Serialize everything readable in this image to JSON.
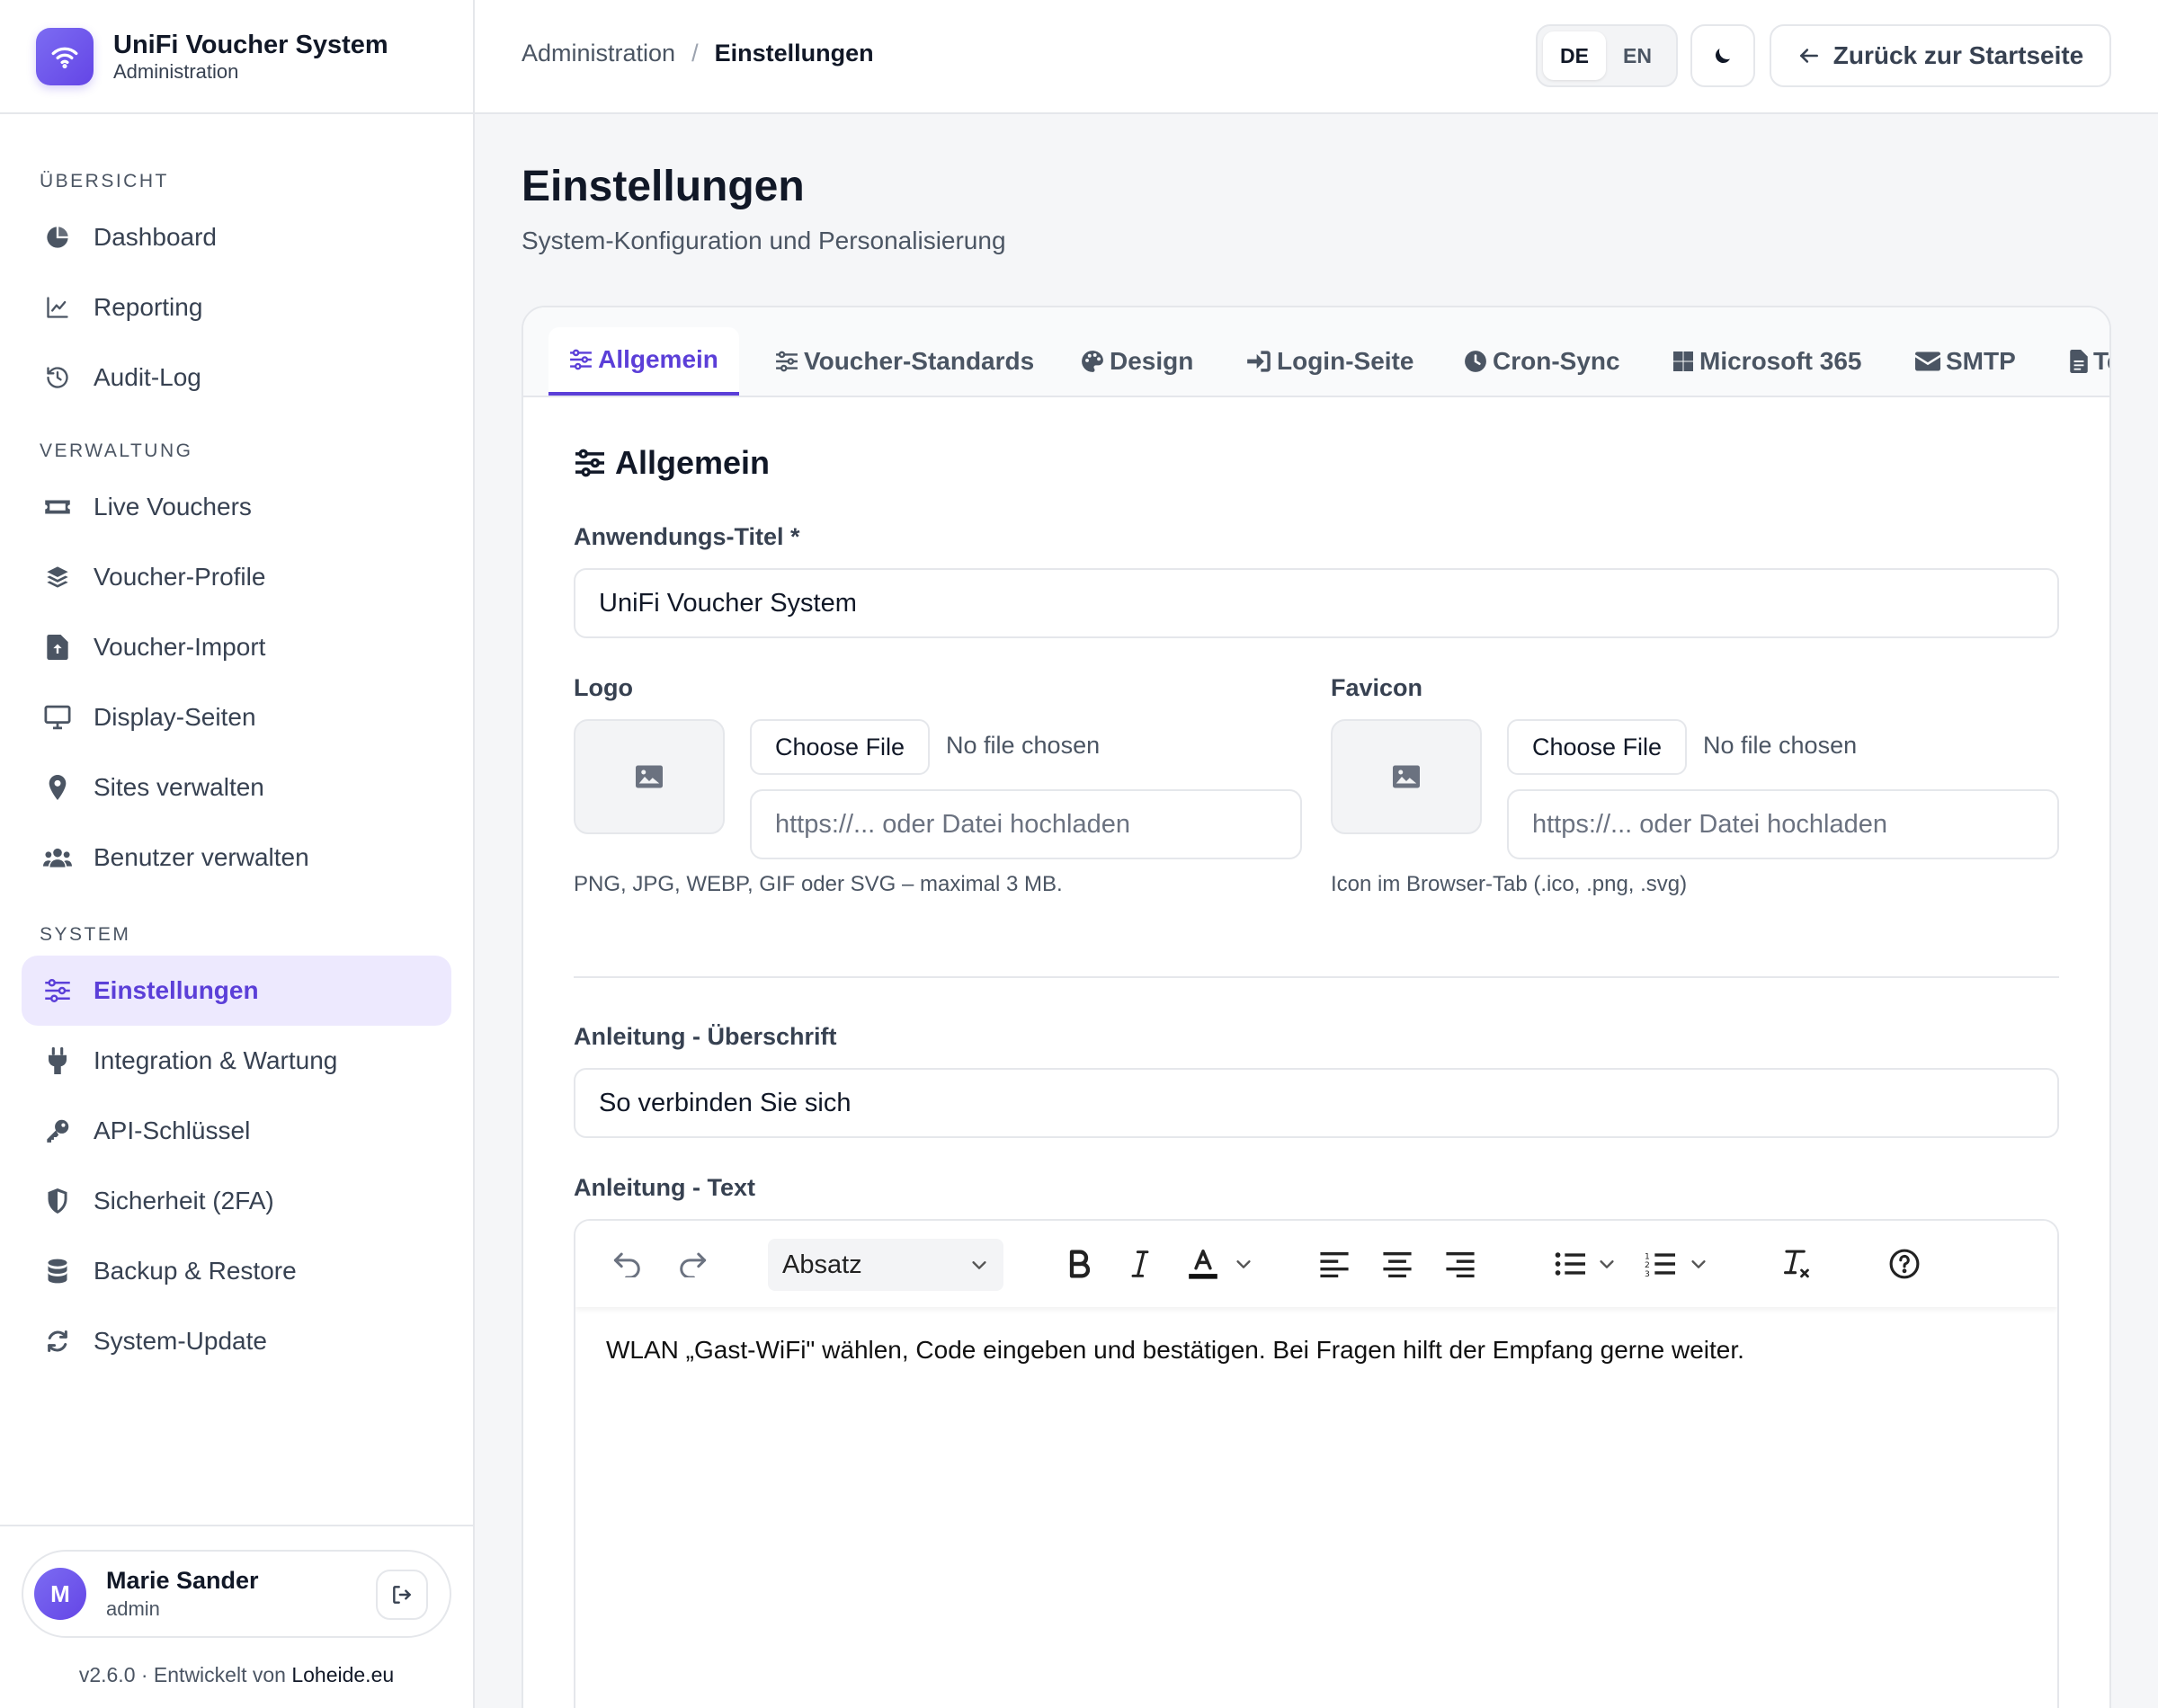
{
  "app": {
    "title": "UniFi Voucher System",
    "subtitle": "Administration"
  },
  "sidebar": {
    "sections": [
      {
        "title": "ÜBERSICHT",
        "items": [
          {
            "label": "Dashboard",
            "icon": "pie-chart-icon"
          },
          {
            "label": "Reporting",
            "icon": "line-chart-icon"
          },
          {
            "label": "Audit-Log",
            "icon": "history-icon"
          }
        ]
      },
      {
        "title": "VERWALTUNG",
        "items": [
          {
            "label": "Live Vouchers",
            "icon": "ticket-icon"
          },
          {
            "label": "Voucher-Profile",
            "icon": "layers-icon"
          },
          {
            "label": "Voucher-Import",
            "icon": "file-upload-icon"
          },
          {
            "label": "Display-Seiten",
            "icon": "monitor-icon"
          },
          {
            "label": "Sites verwalten",
            "icon": "map-pin-icon"
          },
          {
            "label": "Benutzer verwalten",
            "icon": "users-icon"
          }
        ]
      },
      {
        "title": "SYSTEM",
        "items": [
          {
            "label": "Einstellungen",
            "icon": "sliders-icon",
            "active": true
          },
          {
            "label": "Integration & Wartung",
            "icon": "plug-icon"
          },
          {
            "label": "API-Schlüssel",
            "icon": "key-icon"
          },
          {
            "label": "Sicherheit (2FA)",
            "icon": "shield-icon"
          },
          {
            "label": "Backup & Restore",
            "icon": "database-icon"
          },
          {
            "label": "System-Update",
            "icon": "refresh-icon"
          }
        ]
      }
    ],
    "user": {
      "initial": "M",
      "name": "Marie Sander",
      "role": "admin"
    },
    "version_prefix": "v2.6.0 · Entwickelt von ",
    "developer": "Loheide.eu"
  },
  "topbar": {
    "breadcrumb_root": "Administration",
    "breadcrumb_sep": "/",
    "breadcrumb_current": "Einstellungen",
    "lang_de": "DE",
    "lang_en": "EN",
    "active_lang": "DE",
    "back_label": "Zurück zur Startseite"
  },
  "page": {
    "title": "Einstellungen",
    "subtitle": "System-Konfiguration und Personalisierung"
  },
  "tabs": [
    {
      "label": "Allgemein",
      "icon": "sliders-icon",
      "active": true
    },
    {
      "label": "Voucher-Standards",
      "icon": "sliders-icon"
    },
    {
      "label": "Design",
      "icon": "palette-icon"
    },
    {
      "label": "Login-Seite",
      "icon": "sign-in-icon"
    },
    {
      "label": "Cron-Sync",
      "icon": "clock-icon"
    },
    {
      "label": "Microsoft 365",
      "icon": "windows-icon"
    },
    {
      "label": "SMTP",
      "icon": "envelope-icon"
    },
    {
      "label": "Te",
      "icon": "file-icon"
    }
  ],
  "general": {
    "heading": "Allgemein",
    "app_title_label": "Anwendungs-Titel *",
    "app_title_value": "UniFi Voucher System",
    "logo_label": "Logo",
    "favicon_label": "Favicon",
    "choose_file": "Choose File",
    "no_file": "No file chosen",
    "url_placeholder": "https://... oder Datei hochladen",
    "logo_hint": "PNG, JPG, WEBP, GIF oder SVG – maximal 3 MB.",
    "favicon_hint": "Icon im Browser-Tab (.ico, .png, .svg)",
    "instructions_heading_label": "Anleitung - Überschrift",
    "instructions_heading_value": "So verbinden Sie sich",
    "instructions_text_label": "Anleitung - Text",
    "editor_block_format": "Absatz",
    "editor_content": "WLAN „Gast-WiFi\" wählen, Code eingeben und bestätigen. Bei Fragen hilft der Empfang gerne weiter."
  },
  "colors": {
    "accent": "#5b3fd8",
    "accent_bg": "#ede9fe",
    "border": "#e5e7eb",
    "page_bg": "#f5f6f8"
  }
}
